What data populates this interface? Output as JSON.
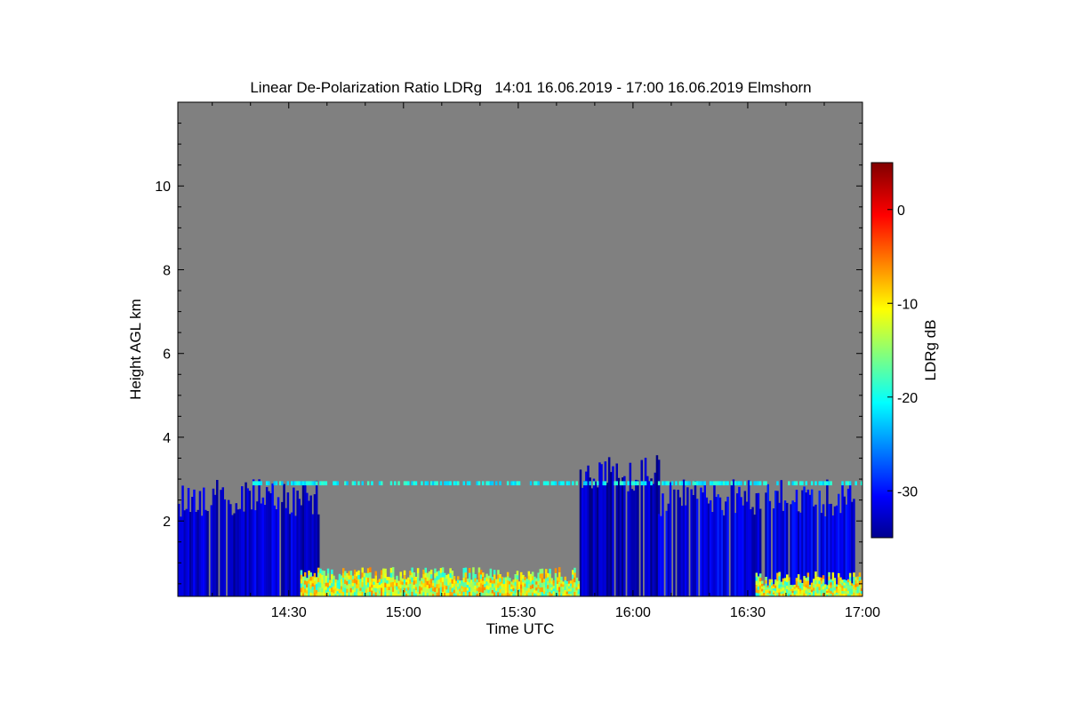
{
  "chart_data": {
    "type": "heatmap",
    "title": "Linear De-Polarization Ratio LDRg   14:01 16.06.2019 - 17:00 16.06.2019 Elmshorn",
    "xlabel": "Time UTC",
    "ylabel": "Height AGL km",
    "x_ticks": [
      "14:30",
      "15:00",
      "15:30",
      "16:00",
      "16:30",
      "17:00"
    ],
    "x_tick_minutes": [
      30,
      60,
      90,
      120,
      150,
      180
    ],
    "xlim_minutes": [
      1,
      180
    ],
    "y_ticks": [
      2,
      4,
      6,
      8,
      10
    ],
    "ylim": [
      0.2,
      12.0
    ],
    "colorbar": {
      "label": "LDRg dB",
      "ticks": [
        0,
        -10,
        -20,
        -30
      ],
      "tick_labels": [
        "0",
        "-10",
        "-20",
        "-30"
      ],
      "range": [
        -35,
        5
      ],
      "colormap": "jet"
    },
    "background_color": "#808080",
    "features": [
      {
        "kind": "cloud",
        "t_start": 1,
        "t_end": 38,
        "h_bottom": 0.2,
        "h_top": 3.0,
        "ldr": -32
      },
      {
        "kind": "cloud",
        "t_start": 106,
        "t_end": 127,
        "h_bottom": 0.2,
        "h_top": 3.6,
        "ldr": -33
      },
      {
        "kind": "cloud",
        "t_start": 126,
        "t_end": 178,
        "h_bottom": 0.2,
        "h_top": 3.0,
        "ldr": -31
      },
      {
        "kind": "aerosol",
        "t_start": 33,
        "t_end": 106,
        "h_bottom": 0.2,
        "h_top": 0.9,
        "ldr": -12
      },
      {
        "kind": "aerosol",
        "t_start": 152,
        "t_end": 180,
        "h_bottom": 0.2,
        "h_top": 0.8,
        "ldr": -12
      },
      {
        "kind": "layer",
        "t_start": 20,
        "t_end": 180,
        "h_bottom": 2.85,
        "h_top": 2.95,
        "ldr": -20
      }
    ]
  }
}
